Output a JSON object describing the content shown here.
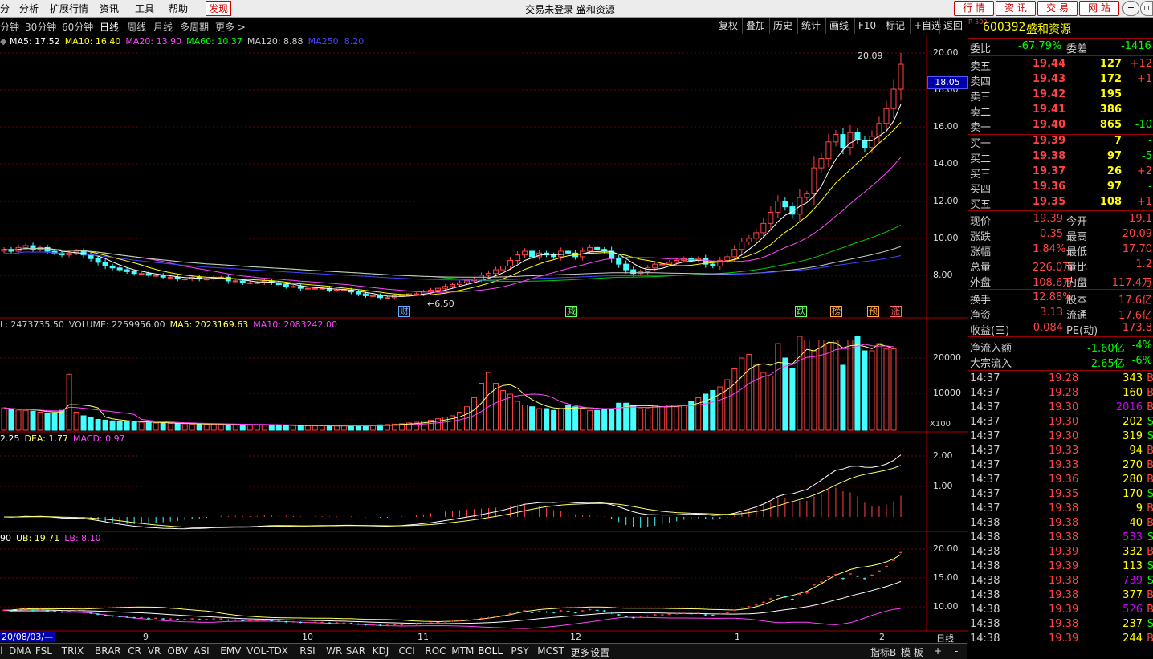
{
  "menu": {
    "items": [
      "分",
      "分析",
      "扩展行情",
      "资讯",
      "工具",
      "帮助",
      "发现"
    ],
    "title": "交易未登录  盛和资源",
    "nav_buttons": [
      "行  情",
      "资  讯",
      "交  易",
      "网  站"
    ]
  },
  "toolbar": {
    "periods": [
      "分钟",
      "30分钟",
      "60分钟",
      "日线",
      "周线",
      "月线",
      "多周期",
      "更多 >"
    ],
    "selected": "日线",
    "right_buttons": [
      "复权",
      "叠加",
      "历史",
      "统计",
      "画线",
      "F10",
      "标记",
      "+自选",
      "返回"
    ]
  },
  "indicators": {
    "ma_line": [
      "MA5: 17.52",
      "MA10: 16.40",
      "MA20: 13.90",
      "MA60: 10.37",
      "MA120: 8.88",
      "MA250: 8.20"
    ],
    "ma_colors": [
      "#ffffff",
      "#ffff00",
      "#ff44ff",
      "#00ff00",
      "#cccccc",
      "#4444ff"
    ],
    "volume_line": [
      "L: 2473735.50",
      "VOLUME: 2259956.00",
      "MA5: 2023169.63",
      "MA10: 2083242.00"
    ],
    "volume_colors": [
      "#cccccc",
      "#cccccc",
      "#ffff66",
      "#ff44ff"
    ],
    "macd_line": [
      "2.25",
      "DEA: 1.77",
      "MACD: 0.97"
    ],
    "macd_colors": [
      "#ffffff",
      "#ffff66",
      "#ff44ff"
    ],
    "boll_line": [
      "90",
      "UB: 19.71",
      "LB: 8.10"
    ],
    "boll_colors": [
      "#ffffff",
      "#ffff66",
      "#ff44ff"
    ]
  },
  "price_axis": [
    "20.00",
    "18.00",
    "16.00",
    "14.00",
    "12.00",
    "10.00",
    "8.00"
  ],
  "current_price_label": "18.05",
  "high_label": "20.09",
  "low_label": "6.50",
  "volume_axis": [
    "20000",
    "10000"
  ],
  "volume_unit": "X100",
  "macd_axis": [
    "2.00",
    "1.00"
  ],
  "boll_axis": [
    "20.00",
    "15.00",
    "10.00"
  ],
  "date_axis": {
    "start": "20/08/03/—",
    "months": [
      "9",
      "10",
      "11",
      "12",
      "1",
      "2"
    ]
  },
  "event_tags": [
    {
      "text": "财",
      "color": "#66aaff"
    },
    {
      "text": "减",
      "color": "#66ff66"
    },
    {
      "text": "跌",
      "color": "#66ff66"
    },
    {
      "text": "榜",
      "color": "#ffaa44"
    },
    {
      "text": "预",
      "color": "#ffaa44"
    },
    {
      "text": "涨",
      "color": "#ff6666"
    }
  ],
  "chart_data": {
    "type": "candlestick",
    "series": "600392 盛和资源 日线",
    "ylim": [
      6.5,
      20.5
    ],
    "close": [
      9.4,
      9.3,
      9.5,
      9.6,
      9.4,
      9.5,
      9.3,
      9.2,
      9.1,
      9.2,
      9.3,
      9.1,
      8.9,
      8.7,
      8.5,
      8.4,
      8.3,
      8.2,
      8.1,
      8.1,
      8.0,
      8.0,
      7.9,
      7.9,
      7.8,
      7.8,
      7.9,
      7.8,
      7.8,
      7.9,
      7.9,
      7.7,
      7.7,
      7.6,
      7.6,
      7.6,
      7.7,
      7.6,
      7.5,
      7.4,
      7.4,
      7.3,
      7.3,
      7.3,
      7.3,
      7.2,
      7.2,
      7.2,
      7.1,
      7.0,
      6.9,
      6.9,
      6.8,
      6.8,
      6.9,
      6.9,
      7.0,
      7.0,
      7.1,
      7.2,
      7.3,
      7.4,
      7.5,
      7.6,
      7.7,
      7.8,
      8.0,
      8.1,
      8.3,
      8.5,
      8.8,
      9.1,
      9.3,
      9.0,
      9.2,
      9.1,
      9.0,
      9.3,
      9.2,
      9.0,
      9.3,
      9.5,
      9.4,
      9.3,
      8.9,
      8.6,
      8.3,
      8.1,
      8.2,
      8.4,
      8.6,
      8.6,
      8.7,
      8.8,
      8.9,
      8.8,
      8.9,
      8.6,
      8.5,
      8.8,
      9.0,
      9.4,
      9.8,
      10.0,
      10.3,
      10.8,
      11.4,
      12.0,
      11.7,
      11.3,
      12.2,
      12.4,
      13.8,
      14.3,
      15.2,
      15.6,
      14.9,
      15.7,
      15.3,
      14.9,
      15.5,
      16.2,
      17.0,
      18.05,
      19.39
    ],
    "volume_x100": [
      6200,
      5800,
      5600,
      5500,
      5300,
      5000,
      4600,
      4800,
      5500,
      15500,
      5000,
      4000,
      3500,
      3000,
      2800,
      2600,
      2500,
      2400,
      2300,
      2200,
      2100,
      2000,
      2000,
      1900,
      1800,
      1800,
      1700,
      1700,
      1700,
      1700,
      1600,
      1600,
      1600,
      1500,
      1500,
      1500,
      1500,
      1400,
      1400,
      1300,
      1300,
      1300,
      1200,
      1200,
      1200,
      1200,
      1200,
      1200,
      1200,
      1300,
      1300,
      1400,
      1500,
      1600,
      1700,
      1800,
      2000,
      2200,
      2500,
      2800,
      3200,
      3600,
      4000,
      5000,
      6500,
      9000,
      13000,
      16000,
      13000,
      11000,
      10000,
      8000,
      7000,
      6500,
      6000,
      6000,
      5500,
      6000,
      7000,
      6500,
      6000,
      5500,
      5500,
      6000,
      6000,
      7500,
      7500,
      7000,
      6000,
      6000,
      7000,
      6500,
      7000,
      6500,
      7000,
      8000,
      9000,
      10000,
      11000,
      12000,
      14000,
      17000,
      20000,
      21000,
      18000,
      16000,
      15000,
      24000,
      20000,
      17000,
      26000,
      25000,
      22000,
      25000,
      24000,
      25000,
      18000,
      25000,
      26000,
      22000,
      22000,
      24000,
      22500,
      22600
    ],
    "macd_axis_lim": [
      -0.5,
      2.5
    ],
    "boll": {
      "ub": 19.71,
      "lb": 8.1
    }
  },
  "quote": {
    "code": "600392",
    "name": "盛和资源",
    "board_tag": "R 500",
    "weibi_label": "委比",
    "weibi_value": "-67.79%",
    "weicha_label": "委差",
    "weicha_value": "-1416",
    "asks": [
      {
        "label": "卖五",
        "price": "19.44",
        "vol": "127",
        "chg": "+12"
      },
      {
        "label": "卖四",
        "price": "19.43",
        "vol": "172",
        "chg": "+1"
      },
      {
        "label": "卖三",
        "price": "19.42",
        "vol": "195",
        "chg": ""
      },
      {
        "label": "卖二",
        "price": "19.41",
        "vol": "386",
        "chg": ""
      },
      {
        "label": "卖一",
        "price": "19.40",
        "vol": "865",
        "chg": "-10"
      }
    ],
    "bids": [
      {
        "label": "买一",
        "price": "19.39",
        "vol": "7",
        "chg": "-"
      },
      {
        "label": "买二",
        "price": "19.38",
        "vol": "97",
        "chg": "-5"
      },
      {
        "label": "买三",
        "price": "19.37",
        "vol": "26",
        "chg": "+2"
      },
      {
        "label": "买四",
        "price": "19.36",
        "vol": "97",
        "chg": "-"
      },
      {
        "label": "买五",
        "price": "19.35",
        "vol": "108",
        "chg": "+1"
      }
    ],
    "stats": [
      {
        "l1": "现价",
        "v1": "19.39",
        "l2": "今开",
        "v2": "19.1"
      },
      {
        "l1": "涨跌",
        "v1": "0.35",
        "l2": "最高",
        "v2": "20.09"
      },
      {
        "l1": "涨幅",
        "v1": "1.84%",
        "l2": "最低",
        "v2": "17.70"
      },
      {
        "l1": "总量",
        "v1": "226.0万",
        "l2": "量比",
        "v2": "1.2"
      },
      {
        "l1": "外盘",
        "v1": "108.6万",
        "l2": "内盘",
        "v2": "117.4万"
      }
    ],
    "stats2": [
      {
        "l1": "换手",
        "v1": "12.88%",
        "l2": "股本",
        "v2": "17.6亿"
      },
      {
        "l1": "净资",
        "v1": "3.13",
        "l2": "流通",
        "v2": "17.6亿"
      },
      {
        "l1": "收益(三)",
        "v1": "0.084",
        "l2": "PE(动)",
        "v2": "173.8"
      }
    ],
    "flows": [
      {
        "label": "净流入额",
        "value": "-1.60亿",
        "pct": "-4%"
      },
      {
        "label": "大宗流入",
        "value": "-2.65亿",
        "pct": "-6%"
      }
    ],
    "ticks": [
      {
        "t": "14:37",
        "p": "19.28",
        "v": "343",
        "s": "B"
      },
      {
        "t": "14:37",
        "p": "19.28",
        "v": "160",
        "s": "B"
      },
      {
        "t": "14:37",
        "p": "19.30",
        "v": "2016",
        "s": "B"
      },
      {
        "t": "14:37",
        "p": "19.30",
        "v": "202",
        "s": "S"
      },
      {
        "t": "14:37",
        "p": "19.30",
        "v": "319",
        "s": "S"
      },
      {
        "t": "14:37",
        "p": "19.33",
        "v": "94",
        "s": "B"
      },
      {
        "t": "14:37",
        "p": "19.33",
        "v": "270",
        "s": "B"
      },
      {
        "t": "14:37",
        "p": "19.36",
        "v": "280",
        "s": "B"
      },
      {
        "t": "14:37",
        "p": "19.35",
        "v": "170",
        "s": "S"
      },
      {
        "t": "14:37",
        "p": "19.38",
        "v": "9",
        "s": "B"
      },
      {
        "t": "14:38",
        "p": "19.38",
        "v": "40",
        "s": "B"
      },
      {
        "t": "14:38",
        "p": "19.38",
        "v": "533",
        "s": "S"
      },
      {
        "t": "14:38",
        "p": "19.39",
        "v": "332",
        "s": "B"
      },
      {
        "t": "14:38",
        "p": "19.39",
        "v": "113",
        "s": "S"
      },
      {
        "t": "14:38",
        "p": "19.38",
        "v": "739",
        "s": "S"
      },
      {
        "t": "14:38",
        "p": "19.38",
        "v": "377",
        "s": "B"
      },
      {
        "t": "14:38",
        "p": "19.39",
        "v": "526",
        "s": "B"
      },
      {
        "t": "14:38",
        "p": "19.38",
        "v": "237",
        "s": "S"
      },
      {
        "t": "14:38",
        "p": "19.39",
        "v": "244",
        "s": "B"
      }
    ]
  },
  "bottom": {
    "tabs": [
      "DMA",
      "FSL",
      "TRIX",
      "BRAR",
      "CR",
      "VR",
      "OBV",
      "ASI",
      "EMV",
      "VOL-TDX",
      "RSI",
      "WR",
      "SAR",
      "KDJ",
      "CCI",
      "ROC",
      "MTM",
      "BOLL",
      "PSY",
      "MCST",
      "更多",
      "设置"
    ],
    "right": [
      "指标B",
      "模 板",
      "+",
      "-"
    ],
    "period_label": "日线"
  },
  "colors": {
    "up": "#ff4444",
    "down": "#44ffff",
    "grid": "#6a0000",
    "border": "#aa0000"
  }
}
